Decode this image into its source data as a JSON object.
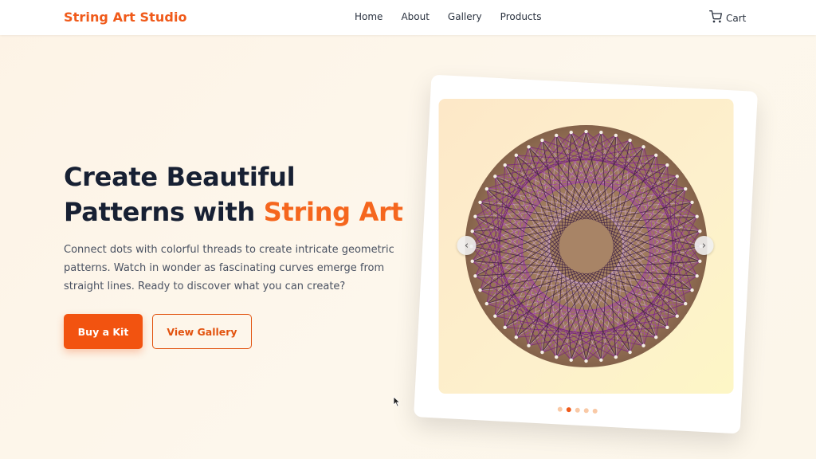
{
  "brand": "String Art Studio",
  "nav": {
    "items": [
      {
        "label": "Home"
      },
      {
        "label": "About"
      },
      {
        "label": "Gallery"
      },
      {
        "label": "Products"
      }
    ],
    "cart_label": "Cart"
  },
  "hero": {
    "title_line1": "Create Beautiful",
    "title_line2_prefix": "Patterns with ",
    "title_accent": "String Art",
    "description": "Connect dots with colorful threads to create intricate geometric patterns. Watch in wonder as fascinating curves emerge from straight lines. Ready to discover what you can create?",
    "buy_label": "Buy a Kit",
    "gallery_label": "View Gallery"
  },
  "carousel": {
    "prev_icon": "chevron-left-icon",
    "next_icon": "chevron-right-icon",
    "slide_count": 5,
    "active_index": 1
  },
  "colors": {
    "accent": "#f05a1a",
    "button": "#f25310",
    "heading": "#172033"
  }
}
